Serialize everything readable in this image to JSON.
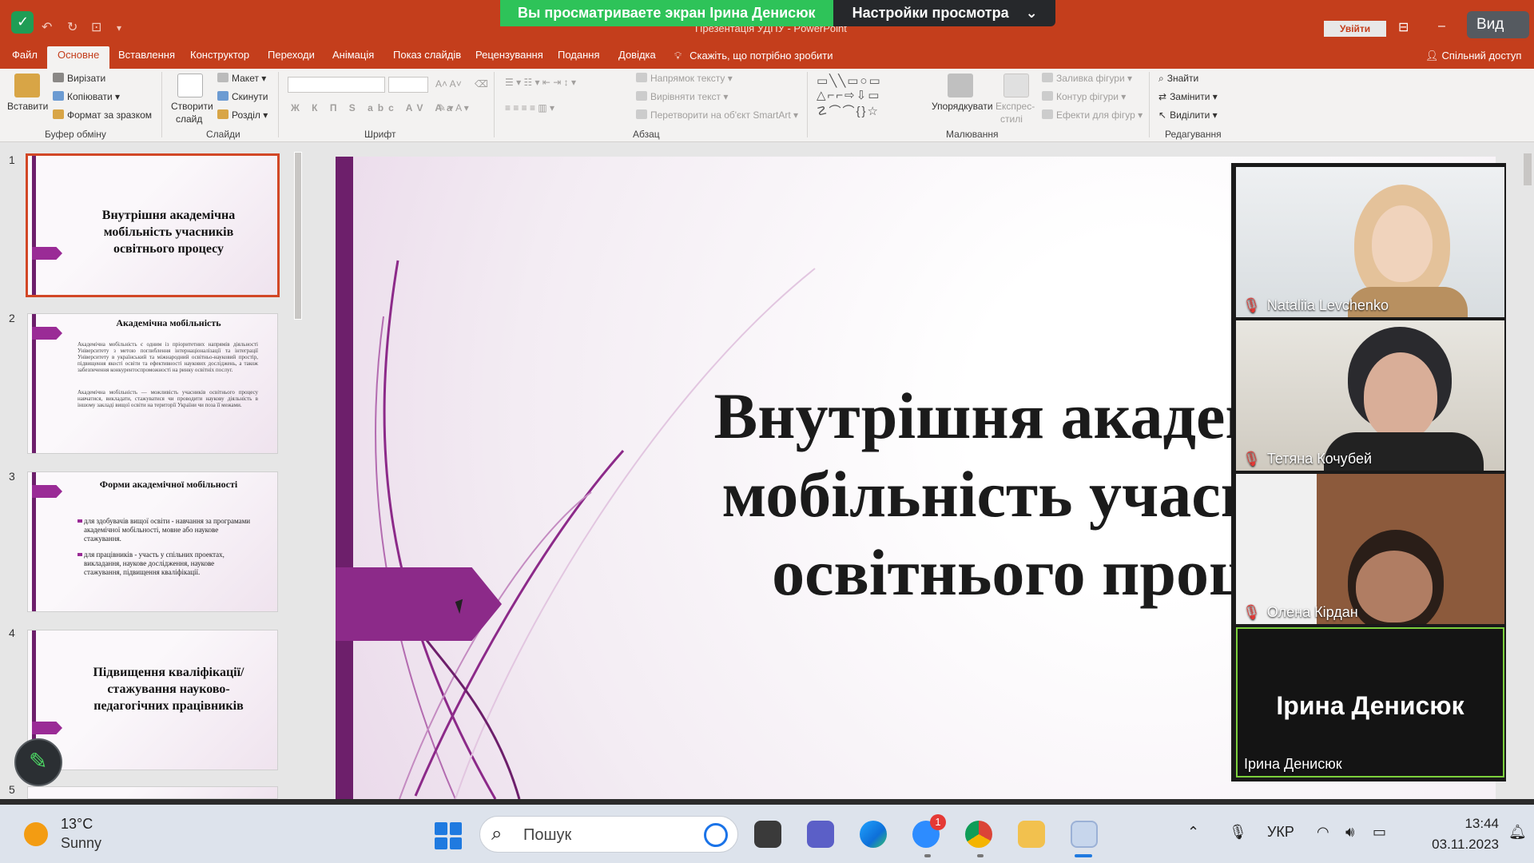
{
  "window": {
    "doc_title": "Презентація УДПУ - PowerPoint",
    "signin_label": "Увійти",
    "view_label": "Вид"
  },
  "zoom_banner": {
    "sharing_text": "Вы просматриваете экран Ірина Денисюк",
    "options_label": "Настройки просмотра",
    "options_chevron": "⌄"
  },
  "ribbon_tabs": [
    "Файл",
    "Основне",
    "Вставлення",
    "Конструктор",
    "Переходи",
    "Анімація",
    "Показ слайдів",
    "Рецензування",
    "Подання",
    "Довідка"
  ],
  "tell_me": "Скажіть, що потрібно зробити",
  "share_access": "Спільний доступ",
  "ribbon": {
    "clipboard": {
      "paste": "Вставити",
      "cut": "Вирізати",
      "copy": "Копіювати",
      "format_painter": "Формат за зразком",
      "label": "Буфер обміну"
    },
    "slides": {
      "new_slide_1": "Створити",
      "new_slide_2": "слайд",
      "layout": "Макет",
      "reset": "Скинути",
      "section": "Розділ",
      "label": "Слайди"
    },
    "font": {
      "label": "Шрифт"
    },
    "paragraph": {
      "text_direction": "Напрямок тексту",
      "align_text": "Вирівняти текст",
      "smartart": "Перетворити на об'єкт SmartArt",
      "label": "Абзац"
    },
    "drawing": {
      "arrange": "Упорядкувати",
      "quick_styles_1": "Експрес-",
      "quick_styles_2": "стилі",
      "shape_fill": "Заливка фігури",
      "shape_outline": "Контур фігури",
      "shape_effects": "Ефекти для фігур",
      "label": "Малювання"
    },
    "editing": {
      "find": "Знайти",
      "replace": "Замінити",
      "select": "Виділити",
      "label": "Редагування"
    }
  },
  "thumbnails": [
    {
      "num": "1",
      "title": "Внутрішня академічна мобільність учасників освітнього процесу"
    },
    {
      "num": "2",
      "title": "Академічна мобільність",
      "body_1": "Академічна мобільність є одним із пріоритетних напрямів діяльності Університету з метою поглиблення інтернаціоналізації та інтеграції Університету в український та міжнародний освітньо-науковий простір, підвищення якості освіти та ефективності наукових досліджень, а також забезпечення конкурентоспроможності на ринку освітніх послуг.",
      "body_2": "Академічна мобільність — можливість учасників освітнього процесу навчатися, викладати, стажуватися чи проводити наукову діяльність в іншому закладі вищої освіти на території України чи поза її межами."
    },
    {
      "num": "3",
      "title": "Форми академічної мобільності",
      "bullet_1": "для здобувачів вищої освіти - навчання за програмами академічної мобільності, мовне або наукове стажування.",
      "bullet_2": "для працівників - участь у спільних проектах, викладання, наукове дослідження, наукове стажування, підвищення кваліфікації."
    },
    {
      "num": "4",
      "title": "Підвищення кваліфікації/стажування науково-педагогічних працівників"
    },
    {
      "num": "5"
    }
  ],
  "slide": {
    "title_line_1": "Внутрішня академічна",
    "title_line_2": "мобільність учасників",
    "title_line_3": "освітнього процесу"
  },
  "participants": [
    {
      "name": "Nataliia Levchenko",
      "muted": true
    },
    {
      "name": "Тетяна Кочубей",
      "muted": true
    },
    {
      "name": "Олена Кірдан",
      "muted": true
    },
    {
      "name": "Ірина Денисюк",
      "display": "Ірина Денисюк",
      "muted": false
    }
  ],
  "taskbar": {
    "temperature": "13°C",
    "condition": "Sunny",
    "search_placeholder": "Пошук",
    "zoom_badge": "1",
    "language": "УКР",
    "time": "13:44",
    "date": "03.11.2023"
  }
}
